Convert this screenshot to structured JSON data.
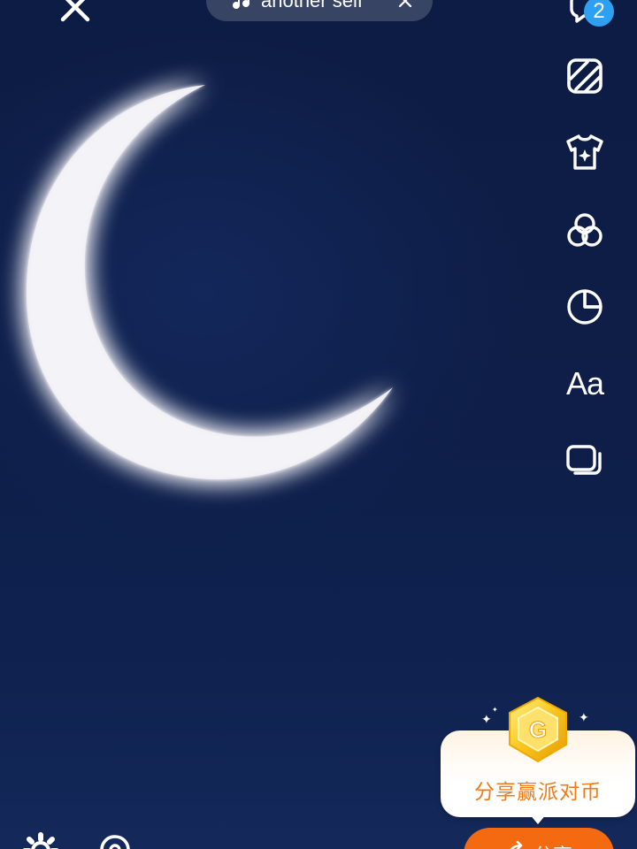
{
  "music": {
    "title": "another self",
    "icon": "music-note-icon",
    "close_icon": "close-icon"
  },
  "top_bar": {
    "close_icon": "close-icon"
  },
  "toolbar": {
    "items": [
      {
        "name": "comments",
        "icon": "comment-icon",
        "badge": "2"
      },
      {
        "name": "background-texture",
        "icon": "texture-icon"
      },
      {
        "name": "outfit",
        "icon": "tshirt-icon"
      },
      {
        "name": "filters",
        "icon": "filter-circles-icon"
      },
      {
        "name": "sticker",
        "icon": "sticker-icon"
      },
      {
        "name": "text",
        "icon": "text-icon",
        "label": "Aa"
      },
      {
        "name": "layers",
        "icon": "layers-icon"
      }
    ]
  },
  "promo": {
    "text": "分享赢派对币",
    "icon": "coin-icon"
  },
  "share": {
    "label": "分享",
    "icon": "share-icon"
  },
  "bottom": {
    "settings_icon": "gear-icon",
    "location_icon": "pin-icon"
  },
  "colors": {
    "background": "#0e1d45",
    "moon": "#ecebf0",
    "badge": "#2ea0f2",
    "share_button": "#f46a10",
    "promo_text": "#f07a16"
  }
}
